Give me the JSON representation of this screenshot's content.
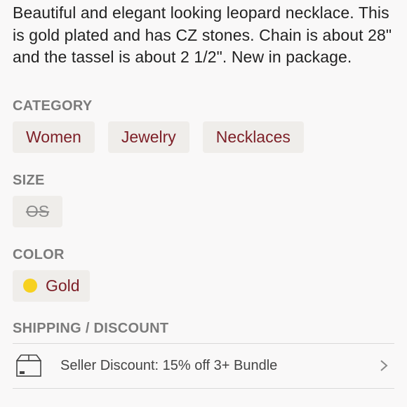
{
  "description": "Beautiful and elegant looking leopard necklace. This is gold plated and has CZ stones. Chain is about 28\" and the tassel is about 2 1/2\". New in package.",
  "category": {
    "heading": "CATEGORY",
    "items": [
      "Women",
      "Jewelry",
      "Necklaces"
    ]
  },
  "size": {
    "heading": "SIZE",
    "value": "OS"
  },
  "color": {
    "heading": "COLOR",
    "value": "Gold",
    "swatch": "#f7d11f"
  },
  "shipping": {
    "heading": "SHIPPING / DISCOUNT",
    "discount_text": "Seller Discount: 15% off 3+ Bundle",
    "icon": "package-box-icon"
  },
  "colors": {
    "chip_text": "#7d1f27",
    "chip_bg": "#efedea",
    "heading": "#7b7b7b"
  }
}
